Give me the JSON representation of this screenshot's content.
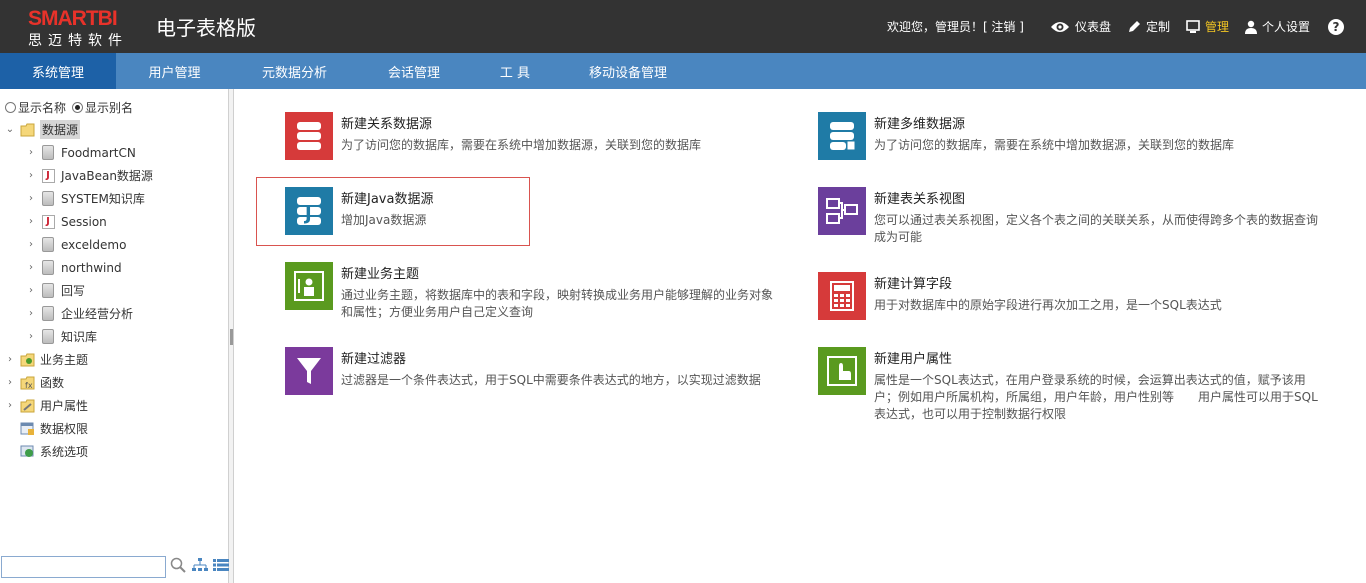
{
  "header": {
    "logo_text": "SMARTBI",
    "logo_sub": "思迈特软件",
    "app_title": "电子表格版",
    "welcome": "欢迎您，管理员！[ 注销 ]",
    "nav": [
      {
        "label": "仪表盘",
        "icon": "eye-icon"
      },
      {
        "label": "定制",
        "icon": "pencil-icon"
      },
      {
        "label": "管理",
        "icon": "monitor-icon",
        "active": true
      },
      {
        "label": "个人设置",
        "icon": "user-icon"
      }
    ],
    "help": "?"
  },
  "navbar": {
    "tabs": [
      {
        "label": "系统管理",
        "active": true
      },
      {
        "label": "用户管理"
      },
      {
        "label": "元数据分析"
      },
      {
        "label": "会话管理"
      },
      {
        "label": "工 具"
      },
      {
        "label": "移动设备管理"
      }
    ]
  },
  "sidebar": {
    "radio_name": "显示名称",
    "radio_alias": "显示别名",
    "tree": [
      {
        "label": "数据源",
        "level": 0,
        "expanded": true,
        "icon": "folder-icon",
        "selected": true
      },
      {
        "label": "FoodmartCN",
        "level": 1,
        "icon": "database-icon"
      },
      {
        "label": "JavaBean数据源",
        "level": 1,
        "icon": "java-icon"
      },
      {
        "label": "SYSTEM知识库",
        "level": 1,
        "icon": "database-icon"
      },
      {
        "label": "Session",
        "level": 1,
        "icon": "java-icon"
      },
      {
        "label": "exceldemo",
        "level": 1,
        "icon": "database-icon"
      },
      {
        "label": "northwind",
        "level": 1,
        "icon": "database-icon"
      },
      {
        "label": "回写",
        "level": 1,
        "icon": "database-icon"
      },
      {
        "label": "企业经营分析",
        "level": 1,
        "icon": "database-icon"
      },
      {
        "label": "知识库",
        "level": 1,
        "icon": "database-icon"
      },
      {
        "label": "业务主题",
        "level": 0,
        "icon": "business-icon"
      },
      {
        "label": "函数",
        "level": 0,
        "icon": "function-icon"
      },
      {
        "label": "用户属性",
        "level": 0,
        "icon": "user-attr-icon"
      },
      {
        "label": "数据权限",
        "level": 0,
        "icon": "permission-icon",
        "leaf": true
      },
      {
        "label": "系统选项",
        "level": 0,
        "icon": "system-icon",
        "leaf": true
      }
    ],
    "search_placeholder": ""
  },
  "cards": [
    {
      "title": "新建关系数据源",
      "desc": "为了访问您的数据库，需要在系统中增加数据源，关联到您的数据库",
      "color": "#d63a3a",
      "icon": "relational-db-icon"
    },
    {
      "title": "新建多维数据源",
      "desc": "为了访问您的数据库，需要在系统中增加数据源，关联到您的数据库",
      "color": "#1f7ba6",
      "icon": "multidim-db-icon"
    },
    {
      "title": "新建Java数据源",
      "desc": "增加Java数据源",
      "color": "#1f7ba6",
      "icon": "java-db-icon"
    },
    {
      "title": "新建表关系视图",
      "desc": "您可以通过表关系视图，定义各个表之间的关联关系，从而使得跨多个表的数据查询成为可能",
      "color": "#6b3f9c",
      "icon": "table-relation-icon"
    },
    {
      "title": "新建业务主题",
      "desc": "通过业务主题，将数据库中的表和字段，映射转换成业务用户能够理解的业务对象和属性；方便业务用户自己定义查询",
      "color": "#5a9a1f",
      "icon": "business-theme-icon"
    },
    {
      "title": "新建计算字段",
      "desc": "用于对数据库中的原始字段进行再次加工之用，是一个SQL表达式",
      "color": "#d63a3a",
      "icon": "calculator-icon"
    },
    {
      "title": "新建过滤器",
      "desc": "过滤器是一个条件表达式，用于SQL中需要条件表达式的地方，以实现过滤数据",
      "color": "#7b3a9c",
      "icon": "filter-icon"
    },
    {
      "title": "新建用户属性",
      "desc": "属性是一个SQL表达式，在用户登录系统的时候，会运算出表达式的值，赋予该用户；例如用户所属机构，所属组，用户年龄，用户性别等　　用户属性可以用于SQL表达式，也可以用于控制数据行权限",
      "color": "#5a9a1f",
      "icon": "user-property-icon"
    }
  ]
}
